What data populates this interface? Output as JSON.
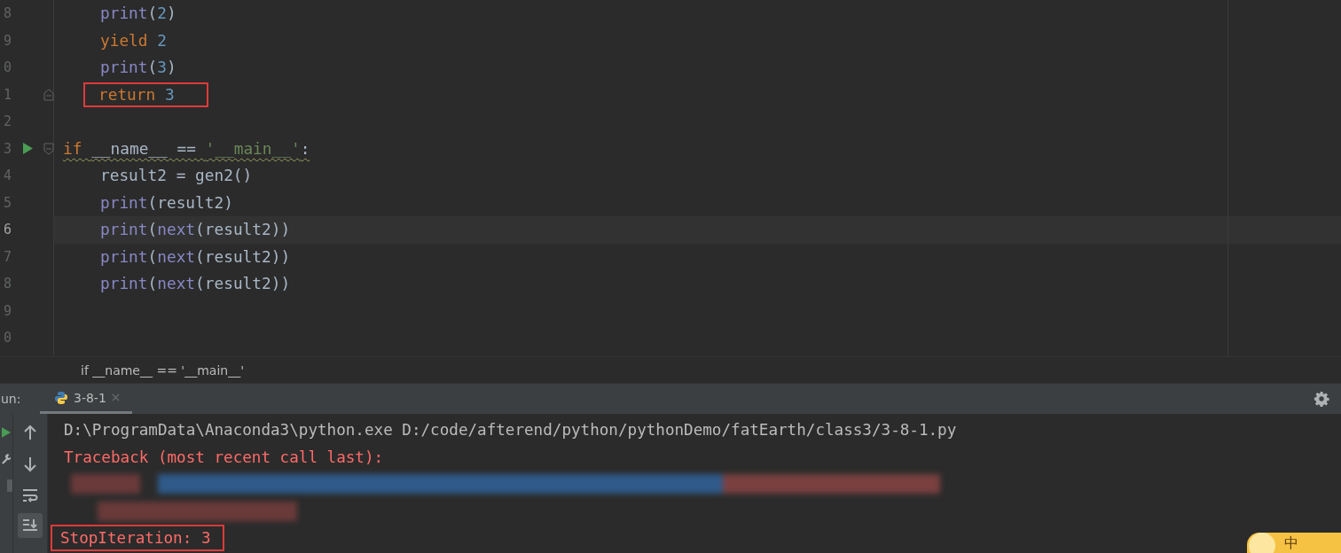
{
  "editor": {
    "lines": [
      {
        "number": "8",
        "indented": true,
        "current": false,
        "annotated": false,
        "warning": false,
        "tokens": [
          {
            "kind": "builtin",
            "text": "print"
          },
          {
            "kind": "plain",
            "text": "("
          },
          {
            "kind": "number",
            "text": "2"
          },
          {
            "kind": "plain",
            "text": ")"
          }
        ]
      },
      {
        "number": "9",
        "indented": true,
        "current": false,
        "annotated": false,
        "warning": false,
        "tokens": [
          {
            "kind": "keyword",
            "text": "yield "
          },
          {
            "kind": "number",
            "text": "2"
          }
        ]
      },
      {
        "number": "0",
        "indented": true,
        "current": false,
        "annotated": false,
        "warning": false,
        "tokens": [
          {
            "kind": "builtin",
            "text": "print"
          },
          {
            "kind": "plain",
            "text": "("
          },
          {
            "kind": "number",
            "text": "3"
          },
          {
            "kind": "plain",
            "text": ")"
          }
        ]
      },
      {
        "number": "1",
        "indented": true,
        "current": false,
        "annotated": true,
        "warning": false,
        "gutter": [
          {
            "kind": "foldend"
          }
        ],
        "tokens": [
          {
            "kind": "keyword",
            "text": "return "
          },
          {
            "kind": "number",
            "text": "3"
          }
        ]
      },
      {
        "number": "2",
        "current": false
      },
      {
        "number": "3",
        "indented": false,
        "current": false,
        "annotated": false,
        "warning": true,
        "gutter": [
          {
            "kind": "run"
          },
          {
            "kind": "foldstart"
          }
        ],
        "tokens": [
          {
            "kind": "keyword",
            "text": "if "
          },
          {
            "kind": "plain",
            "text": "__name__ == "
          },
          {
            "kind": "string",
            "text": "'__main__'"
          },
          {
            "kind": "plain",
            "text": ":"
          }
        ]
      },
      {
        "number": "4",
        "indented": true,
        "current": false,
        "annotated": false,
        "warning": false,
        "tokens": [
          {
            "kind": "plain",
            "text": "result2 = gen2()"
          }
        ]
      },
      {
        "number": "5",
        "indented": true,
        "current": false,
        "annotated": false,
        "warning": false,
        "tokens": [
          {
            "kind": "builtin",
            "text": "print"
          },
          {
            "kind": "plain",
            "text": "(result2)"
          }
        ]
      },
      {
        "number": "6",
        "indented": true,
        "current": true,
        "annotated": false,
        "warning": false,
        "tokens": [
          {
            "kind": "builtin",
            "text": "print"
          },
          {
            "kind": "plain",
            "text": "("
          },
          {
            "kind": "builtin",
            "text": "next"
          },
          {
            "kind": "plain",
            "text": "(result2))"
          }
        ]
      },
      {
        "number": "7",
        "indented": true,
        "current": false,
        "annotated": false,
        "warning": false,
        "tokens": [
          {
            "kind": "builtin",
            "text": "print"
          },
          {
            "kind": "plain",
            "text": "("
          },
          {
            "kind": "builtin",
            "text": "next"
          },
          {
            "kind": "plain",
            "text": "(result2))"
          }
        ]
      },
      {
        "number": "8",
        "indented": true,
        "current": false,
        "annotated": false,
        "warning": false,
        "tokens": [
          {
            "kind": "builtin",
            "text": "print"
          },
          {
            "kind": "plain",
            "text": "("
          },
          {
            "kind": "builtin",
            "text": "next"
          },
          {
            "kind": "plain",
            "text": "(result2))"
          }
        ]
      },
      {
        "number": "9",
        "current": false
      },
      {
        "number": "0",
        "current": false
      }
    ]
  },
  "breadcrumb": "if __name__ == '__main__'",
  "run_panel": {
    "label": "un:",
    "tabs": [
      {
        "label": "3-8-1",
        "selected": true
      }
    ],
    "console": [
      {
        "kind": "plain",
        "text": "D:\\ProgramData\\Anaconda3\\python.exe D:/code/afterend/python/pythonDemo/fatEarth/class3/3-8-1.py",
        "annotated": false
      },
      {
        "kind": "error",
        "text": "Traceback (most recent call last):",
        "annotated": false
      },
      {
        "kind": "blurred"
      },
      {
        "kind": "blurredshort"
      },
      {
        "kind": "error",
        "text": "StopIteration: 3",
        "annotated": true
      }
    ]
  },
  "ime_toolbar": {
    "label": "中"
  }
}
